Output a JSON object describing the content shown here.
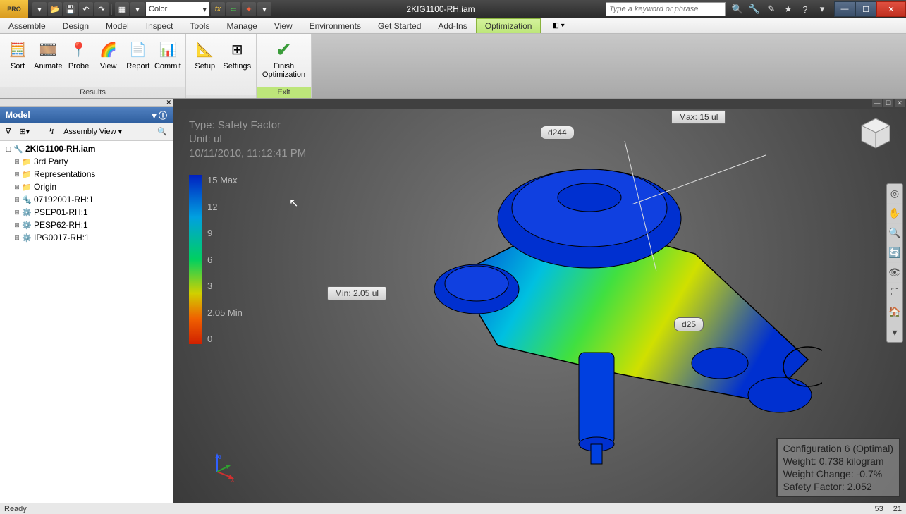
{
  "title": "2KIG1100-RH.iam",
  "app_badge": "PRO",
  "qat": {
    "color_label": "Color"
  },
  "search": {
    "placeholder": "Type a keyword or phrase"
  },
  "menu": {
    "items": [
      "Assemble",
      "Design",
      "Model",
      "Inspect",
      "Tools",
      "Manage",
      "View",
      "Environments",
      "Get Started",
      "Add-Ins",
      "Optimization"
    ],
    "active": "Optimization"
  },
  "ribbon": {
    "panels": [
      {
        "title": "Results",
        "buttons": [
          "Sort",
          "Animate",
          "Probe",
          "View",
          "Report",
          "Commit"
        ]
      },
      {
        "title": "",
        "buttons": [
          "Setup",
          "Settings"
        ]
      },
      {
        "title": "Exit",
        "buttons": [
          "Finish Optimization"
        ],
        "exit": true
      }
    ]
  },
  "sidebar": {
    "header": "Model",
    "view_label": "Assembly View",
    "tree": {
      "root": "2KIG1100-RH.iam",
      "items": [
        {
          "label": "3rd Party",
          "icon": "folder"
        },
        {
          "label": "Representations",
          "icon": "folder"
        },
        {
          "label": "Origin",
          "icon": "folder"
        },
        {
          "label": "07192001-RH:1",
          "icon": "part"
        },
        {
          "label": "PSEP01-RH:1",
          "icon": "asm"
        },
        {
          "label": "PESP62-RH:1",
          "icon": "asm"
        },
        {
          "label": "IPG0017-RH:1",
          "icon": "asm"
        }
      ]
    }
  },
  "viewport": {
    "info": {
      "type_line": "Type: Safety Factor",
      "unit_line": "Unit: ul",
      "date_line": "10/11/2010, 11:12:41 PM"
    },
    "legend": {
      "ticks": [
        "15 Max",
        "12",
        "9",
        "6",
        "3",
        "2.05 Min",
        "0"
      ]
    },
    "callouts": {
      "max": "Max: 15 ul",
      "min": "Min: 2.05 ul",
      "d244": "d244",
      "d25": "d25"
    },
    "info_box": {
      "l1": "Configuration 6 (Optimal)",
      "l2": "Weight: 0.738 kilogram",
      "l3": "Weight Change: -0.7%",
      "l4": "Safety Factor: 2.052"
    }
  },
  "status": {
    "ready": "Ready",
    "n1": "53",
    "n2": "21"
  }
}
